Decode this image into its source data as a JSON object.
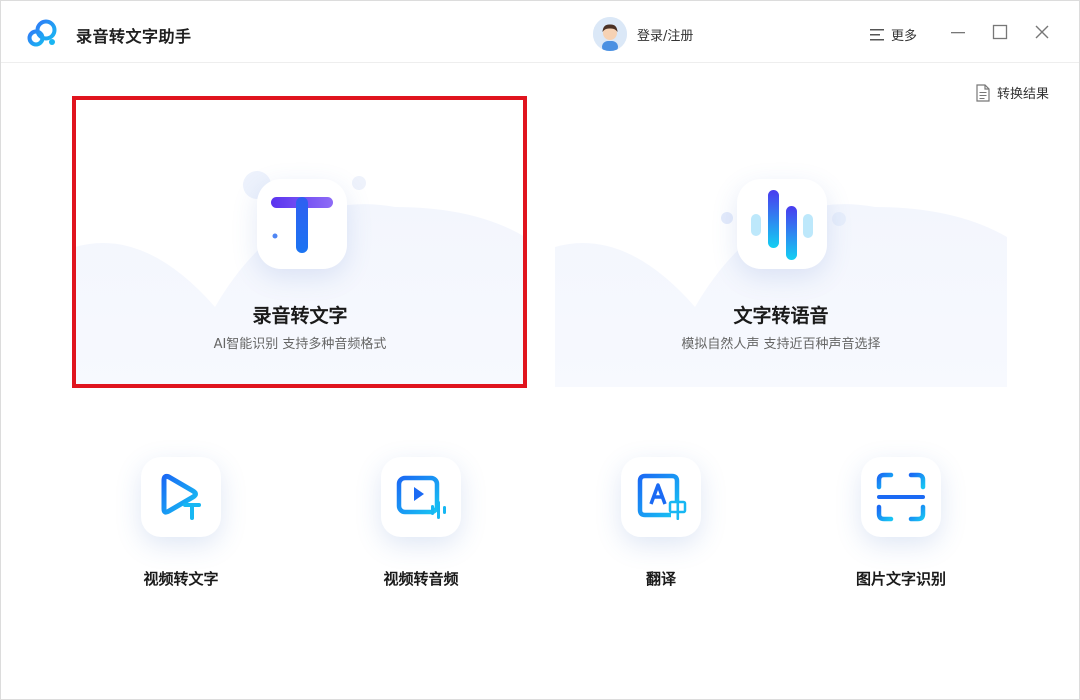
{
  "app": {
    "title": "录音转文字助手",
    "login_label": "登录/注册",
    "more_label": "更多",
    "result_label": "转换结果"
  },
  "cards": [
    {
      "title": "录音转文字",
      "subtitle": "AI智能识别 支持多种音频格式"
    },
    {
      "title": "文字转语音",
      "subtitle": "模拟自然人声 支持近百种声音选择"
    }
  ],
  "tools": [
    {
      "label": "视频转文字",
      "icon": "video-to-text-icon"
    },
    {
      "label": "视频转音频",
      "icon": "video-to-audio-icon"
    },
    {
      "label": "翻译",
      "icon": "translate-icon"
    },
    {
      "label": "图片文字识别",
      "icon": "image-ocr-icon"
    }
  ],
  "colors": {
    "accent": "#1a73f5",
    "selection": "#e0141e",
    "gradient_start": "#5b3cf0",
    "gradient_end": "#13c8f0"
  }
}
